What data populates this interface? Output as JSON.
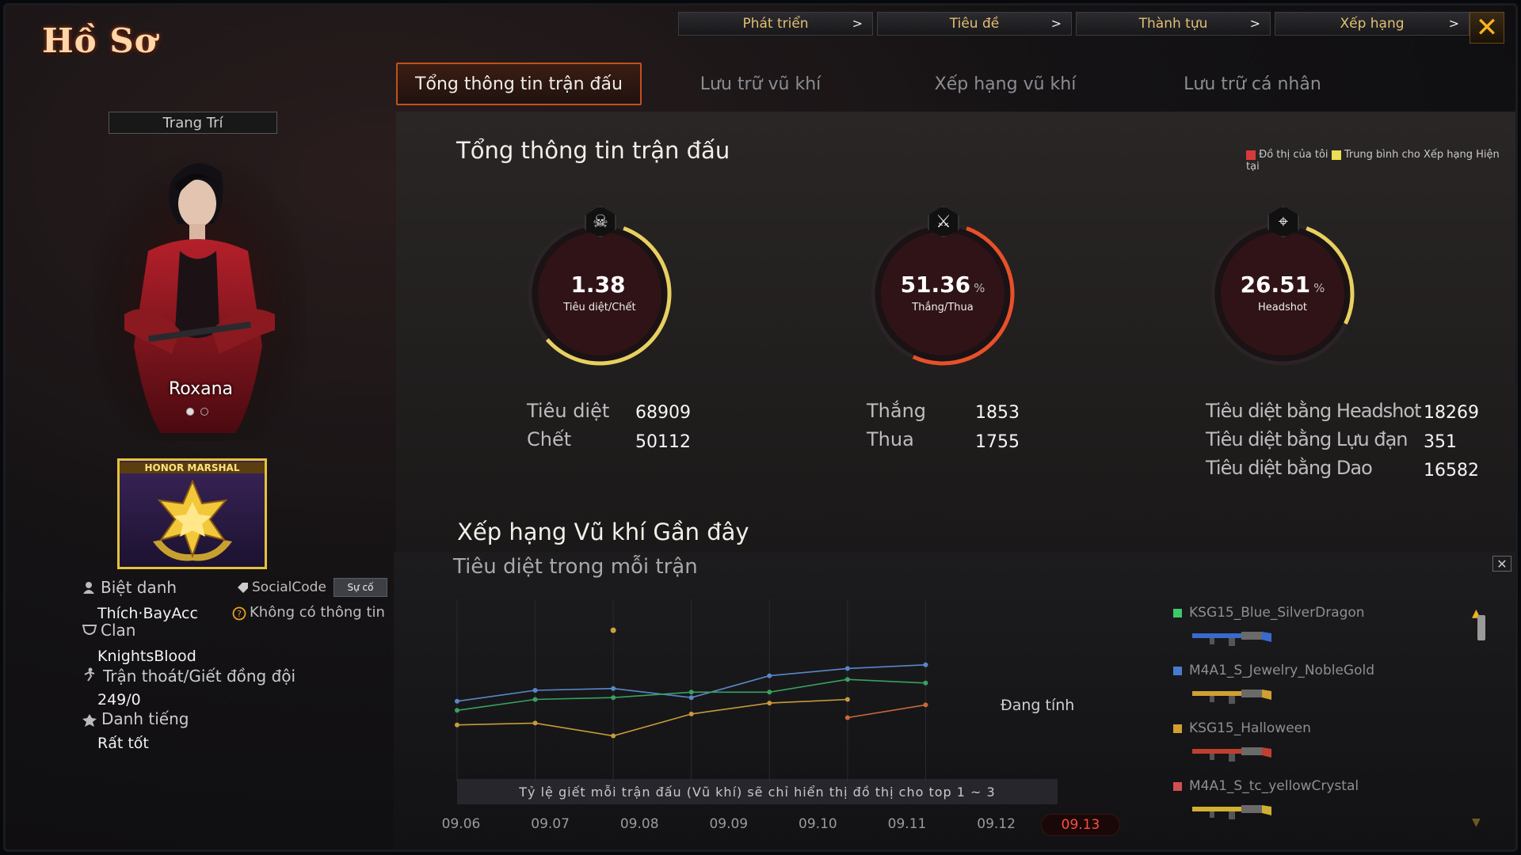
{
  "title": "Hồ Sơ",
  "topnav": [
    {
      "label": "Phát triển"
    },
    {
      "label": "Tiêu đề"
    },
    {
      "label": "Thành tựu"
    },
    {
      "label": "Xếp hạng"
    }
  ],
  "tabs": [
    {
      "label": "Tổng thông tin trận đấu",
      "active": true
    },
    {
      "label": "Lưu trữ vũ khí",
      "active": false
    },
    {
      "label": "Xếp hạng vũ khí",
      "active": false
    },
    {
      "label": "Lưu trữ cá nhân",
      "active": false
    }
  ],
  "profile": {
    "decor_label": "Trang Trí",
    "character_name": "Roxana",
    "rank_label": "HONOR MARSHAL",
    "nickname_label": "Biệt danh",
    "nickname": "Thích·BayAcc",
    "socialcode_label": "SocialCode",
    "socialcode_button": "Sự cố",
    "socialcode_value": "Không có thông tin",
    "clan_label": "Clan",
    "clan": "KnightsBlood",
    "escape_label": "Trận thoát/Giết đồng đội",
    "escape_value": "249/0",
    "reputation_label": "Danh tiếng",
    "reputation": "Rất tốt"
  },
  "summary": {
    "title": "Tổng thông tin trận đấu",
    "legend_mine": "Đồ thị của tôi",
    "legend_avg": "Trung bình cho Xếp hạng Hiện tại",
    "gauges": [
      {
        "value": "1.38",
        "suffix": "",
        "label": "Tiêu diệt/Chết",
        "fill": 0.58,
        "color": "#e8d060"
      },
      {
        "value": "51.36",
        "suffix": "%",
        "label": "Thắng/Thua",
        "fill": 0.5136,
        "color": "#e8502a"
      },
      {
        "value": "26.51",
        "suffix": "%",
        "label": "Headshot",
        "fill": 0.2651,
        "color": "#e8d060"
      }
    ],
    "kd": [
      {
        "label": "Tiêu diệt",
        "value": "68909"
      },
      {
        "label": "Chết",
        "value": "50112"
      }
    ],
    "wl": [
      {
        "label": "Thắng",
        "value": "1853"
      },
      {
        "label": "Thua",
        "value": "1755"
      }
    ],
    "kills": [
      {
        "label": "Tiêu diệt bằng Headshot",
        "value": "18269"
      },
      {
        "label": "Tiêu diệt bằng Lựu đạn",
        "value": "351"
      },
      {
        "label": "Tiêu diệt bằng Dao",
        "value": "16582"
      }
    ]
  },
  "weapon_chart": {
    "section_title": "Xếp hạng Vũ khí Gần đây",
    "subtitle": "Tiêu diệt trong mỗi trận",
    "calculating": "Đang tính",
    "note": "Tỷ lệ giết mỗi trận đấu (Vũ khí) sẽ chỉ hiển thị đồ thị cho top 1 ~ 3",
    "current_date": "09.13"
  },
  "chart_data": {
    "type": "line",
    "x": [
      "09.06",
      "09.07",
      "09.08",
      "09.09",
      "09.10",
      "09.11",
      "09.12",
      "09.13"
    ],
    "ylim": [
      0,
      10
    ],
    "series": [
      {
        "name": "KSG15_Blue_SilverDragon",
        "color": "#5a86c8",
        "values": [
          4.4,
          5.0,
          5.1,
          4.6,
          5.8,
          6.2,
          6.4,
          null
        ]
      },
      {
        "name": "M4A1_S_Jewelry_NobleGold",
        "color": "#3aa060",
        "values": [
          3.9,
          4.5,
          4.6,
          4.9,
          4.9,
          5.6,
          5.4,
          null
        ]
      },
      {
        "name": "KSG15_Halloween",
        "color": "#c89a3a",
        "values": [
          3.1,
          3.2,
          2.5,
          3.7,
          4.3,
          4.5,
          null,
          null
        ]
      },
      {
        "name": "M4A1_S_tc_yellowCrystal",
        "color": "#c86a3a",
        "values": [
          null,
          null,
          null,
          null,
          null,
          3.5,
          4.2,
          null
        ]
      }
    ],
    "extra_points": [
      {
        "x": "09.08",
        "y": 8.3,
        "color": "#c8a040"
      }
    ]
  },
  "weapon_list": [
    {
      "name": "KSG15_Blue_SilverDragon",
      "color": "#3ec86a",
      "gun": "#3a6ad0"
    },
    {
      "name": "M4A1_S_Jewelry_NobleGold",
      "color": "#4a7ad0",
      "gun": "#d0a030"
    },
    {
      "name": "KSG15_Halloween",
      "color": "#d0a030",
      "gun": "#c04030"
    },
    {
      "name": "M4A1_S_tc_yellowCrystal",
      "color": "#d05050",
      "gun": "#d0b030"
    }
  ]
}
